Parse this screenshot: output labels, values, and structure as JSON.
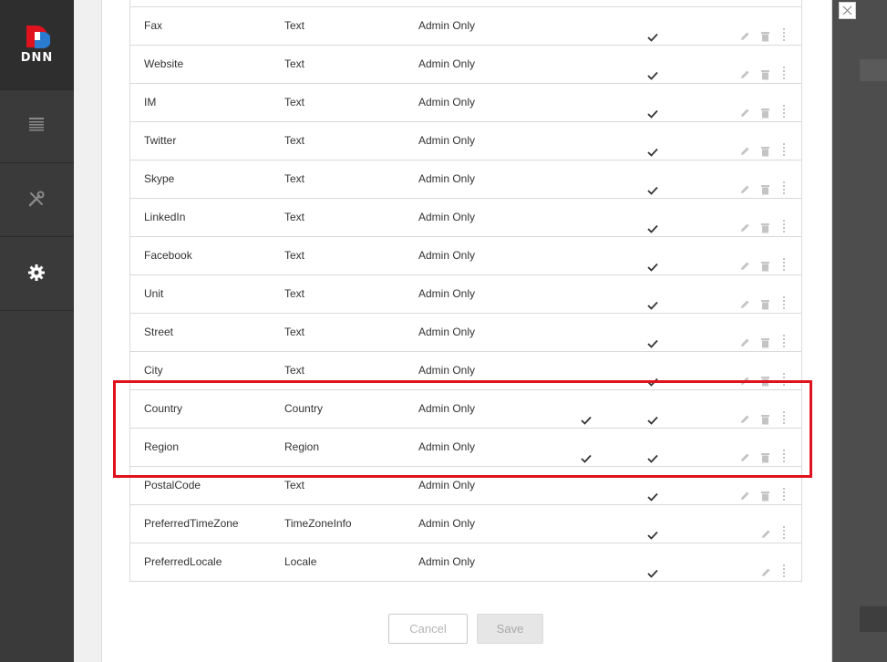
{
  "app": {
    "logo_text": "DNN"
  },
  "sidebar": {
    "items": [
      {
        "icon": "content-icon"
      },
      {
        "icon": "tools-icon"
      },
      {
        "icon": "settings-icon"
      }
    ]
  },
  "colors": {
    "highlight": "#e0121e",
    "sidebar": "#3a3a3a",
    "check": "#333333"
  },
  "rows": [
    {
      "name": "Fax",
      "type": "Text",
      "visibility": "Admin Only",
      "required": false,
      "enabled": true,
      "deletable": true
    },
    {
      "name": "Website",
      "type": "Text",
      "visibility": "Admin Only",
      "required": false,
      "enabled": true,
      "deletable": true
    },
    {
      "name": "IM",
      "type": "Text",
      "visibility": "Admin Only",
      "required": false,
      "enabled": true,
      "deletable": true
    },
    {
      "name": "Twitter",
      "type": "Text",
      "visibility": "Admin Only",
      "required": false,
      "enabled": true,
      "deletable": true
    },
    {
      "name": "Skype",
      "type": "Text",
      "visibility": "Admin Only",
      "required": false,
      "enabled": true,
      "deletable": true
    },
    {
      "name": "LinkedIn",
      "type": "Text",
      "visibility": "Admin Only",
      "required": false,
      "enabled": true,
      "deletable": true
    },
    {
      "name": "Facebook",
      "type": "Text",
      "visibility": "Admin Only",
      "required": false,
      "enabled": true,
      "deletable": true
    },
    {
      "name": "Unit",
      "type": "Text",
      "visibility": "Admin Only",
      "required": false,
      "enabled": true,
      "deletable": true
    },
    {
      "name": "Street",
      "type": "Text",
      "visibility": "Admin Only",
      "required": false,
      "enabled": true,
      "deletable": true
    },
    {
      "name": "City",
      "type": "Text",
      "visibility": "Admin Only",
      "required": false,
      "enabled": true,
      "deletable": true
    },
    {
      "name": "Country",
      "type": "Country",
      "visibility": "Admin Only",
      "required": true,
      "enabled": true,
      "deletable": true
    },
    {
      "name": "Region",
      "type": "Region",
      "visibility": "Admin Only",
      "required": true,
      "enabled": true,
      "deletable": true
    },
    {
      "name": "PostalCode",
      "type": "Text",
      "visibility": "Admin Only",
      "required": false,
      "enabled": true,
      "deletable": true
    },
    {
      "name": "PreferredTimeZone",
      "type": "TimeZoneInfo",
      "visibility": "Admin Only",
      "required": false,
      "enabled": true,
      "deletable": false
    },
    {
      "name": "PreferredLocale",
      "type": "Locale",
      "visibility": "Admin Only",
      "required": false,
      "enabled": true,
      "deletable": false
    }
  ],
  "footer": {
    "cancel_label": "Cancel",
    "save_label": "Save"
  }
}
